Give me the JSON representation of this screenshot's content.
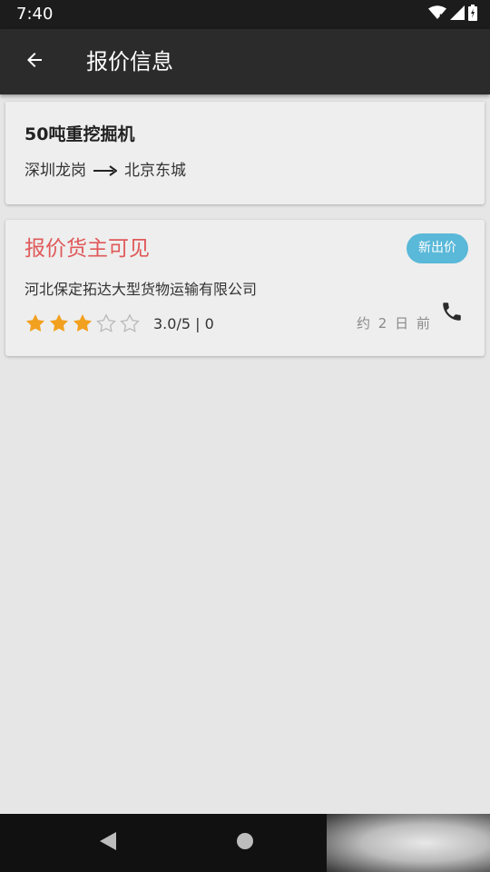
{
  "status_bar": {
    "time": "7:40",
    "icons": [
      "wifi-icon",
      "signal-icon",
      "battery-icon"
    ]
  },
  "app_bar": {
    "title": "报价信息",
    "back_icon": "arrow-back-icon"
  },
  "cargo": {
    "name": "50吨重挖掘机",
    "origin": "深圳龙岗",
    "destination": "北京东城",
    "arrow_icon": "long-arrow-right-icon"
  },
  "quote": {
    "title": "报价货主可见",
    "badge": "新出价",
    "company": "河北保定拓达大型货物运输有限公司",
    "rating": 3,
    "rating_max": 5,
    "rating_text": "3.0/5 | 0",
    "time_ago": "约 2 日 前",
    "phone_icon": "phone-icon"
  },
  "colors": {
    "quote_title": "#e0595a",
    "badge_bg": "#5ab8d8",
    "star_filled": "#f2a01f",
    "star_empty": "#b9b9b9",
    "app_bar": "#2b2b2b",
    "background": "#e6e6e6"
  },
  "nav_bar": {
    "icons": [
      "nav-back-icon",
      "nav-home-icon"
    ]
  }
}
